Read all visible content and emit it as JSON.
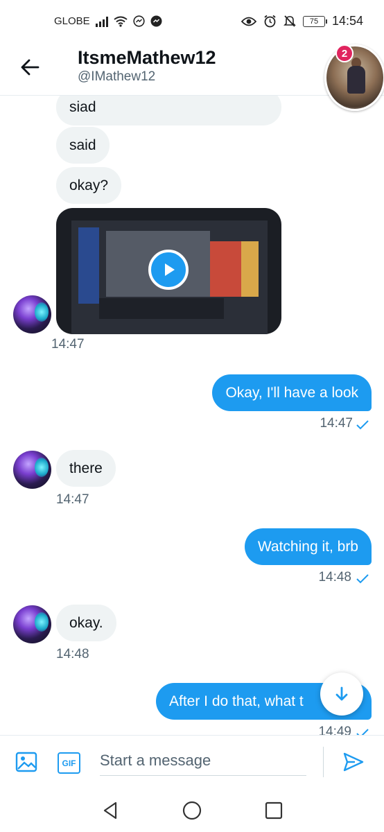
{
  "status_bar": {
    "carrier": "GLOBE",
    "battery": "75",
    "time": "14:54",
    "icons": [
      "signal-icon",
      "wifi-icon",
      "messenger-icon",
      "messenger-icon",
      "eye-icon",
      "alarm-icon",
      "mute-icon",
      "battery-icon"
    ]
  },
  "header": {
    "name": "ItsmeMathew12",
    "handle": "@IMathew12",
    "notification_count": "2"
  },
  "messages": [
    {
      "side": "in",
      "text": "siad"
    },
    {
      "side": "in",
      "text": "said"
    },
    {
      "side": "in",
      "text": "okay?"
    },
    {
      "side": "in",
      "type": "video",
      "time": "14:47"
    },
    {
      "side": "out",
      "text": "Okay, I'll have a look",
      "time": "14:47"
    },
    {
      "side": "in",
      "text": "there",
      "time": "14:47"
    },
    {
      "side": "out",
      "text": "Watching it, brb",
      "time": "14:48"
    },
    {
      "side": "in",
      "text": "okay.",
      "time": "14:48"
    },
    {
      "side": "out",
      "text": "After I do that, what t",
      "time": "14:49"
    }
  ],
  "composer": {
    "gif_label": "GIF",
    "placeholder": "Start a message"
  },
  "colors": {
    "accent": "#1d9bf0",
    "incoming_bubble": "#eff3f4",
    "badge": "#e0245e"
  }
}
